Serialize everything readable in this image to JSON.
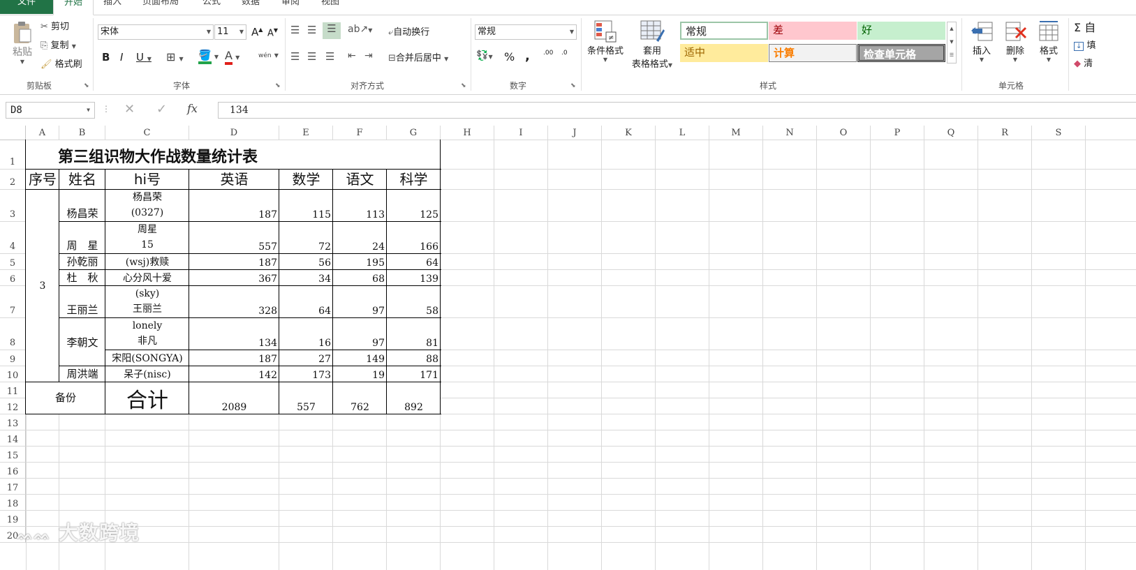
{
  "ribbon_tabs": [
    "文件",
    "开始",
    "插入",
    "页面布局",
    "公式",
    "数据",
    "审阅",
    "视图"
  ],
  "clipboard": {
    "paste": "粘贴",
    "cut": "剪切",
    "copy": "复制",
    "painter": "格式刷",
    "label": "剪贴板"
  },
  "font": {
    "name": "宋体",
    "size": "11",
    "label": "字体",
    "bold": "B",
    "italic": "I",
    "underline": "U",
    "grow": "A",
    "shrink": "A",
    "color_letter": "A",
    "wen": "wén"
  },
  "alignment": {
    "wrap": "自动换行",
    "merge": "合并后居中",
    "label": "对齐方式"
  },
  "number": {
    "format": "常规",
    "percent": "%",
    "comma": ",",
    "inc": ".00",
    "dec": ".0",
    "label": "数字"
  },
  "styles": {
    "conditional": "条件格式",
    "table_fmt_1": "套用",
    "table_fmt_2": "表格格式",
    "cells": [
      "常规",
      "差",
      "好",
      "适中",
      "计算",
      "检查单元格"
    ],
    "label": "样式"
  },
  "cells_group": {
    "insert": "插入",
    "delete": "删除",
    "format": "格式",
    "label": "单元格"
  },
  "editing": {
    "sum": "Σ 自",
    "fill": "填",
    "clear": "清"
  },
  "formula_bar": {
    "name_box": "D8",
    "fx": "fx",
    "value": "134"
  },
  "columns": [
    "A",
    "B",
    "C",
    "D",
    "E",
    "F",
    "G",
    "H",
    "I",
    "J",
    "K",
    "L",
    "M",
    "N",
    "O",
    "P",
    "Q",
    "R",
    "S"
  ],
  "rows": [
    "1",
    "2",
    "3",
    "4",
    "5",
    "6",
    "7",
    "8",
    "9",
    "10",
    "11",
    "12",
    "13",
    "14",
    "15",
    "16",
    "17",
    "18",
    "19",
    "20"
  ],
  "sheet": {
    "title": "第三组识物大作战数量统计表",
    "headers": [
      "序号",
      "姓名",
      "hi号",
      "英语",
      "数学",
      "语文",
      "科学"
    ],
    "group_no": "3",
    "records": [
      {
        "name": "杨昌荣",
        "hi_1": "杨昌荣",
        "hi_2": "(0327)",
        "en": "187",
        "math": "115",
        "cn": "113",
        "sci": "125"
      },
      {
        "name": "周　星",
        "hi_1": "周星",
        "hi_2": "15",
        "en": "557",
        "math": "72",
        "cn": "24",
        "sci": "166"
      },
      {
        "name": "孙乾丽",
        "hi_1": "(wsj)救赎",
        "hi_2": "",
        "en": "187",
        "math": "56",
        "cn": "195",
        "sci": "64"
      },
      {
        "name": "杜　秋",
        "hi_1": "心分风十爱",
        "hi_2": "",
        "en": "367",
        "math": "34",
        "cn": "68",
        "sci": "139"
      },
      {
        "name": "王丽兰",
        "hi_1": "(sky)",
        "hi_2": "王丽兰",
        "en": "328",
        "math": "64",
        "cn": "97",
        "sci": "58"
      },
      {
        "name": "李朝文",
        "hi_1": "lonely",
        "hi_2": "非凡",
        "en": "134",
        "math": "16",
        "cn": "97",
        "sci": "81"
      },
      {
        "name": "",
        "hi_1": "宋阳(SONGYA)",
        "hi_2": "",
        "en": "187",
        "math": "27",
        "cn": "149",
        "sci": "88"
      },
      {
        "name": "周洪端",
        "hi_1": "呆子(nisc)",
        "hi_2": "",
        "en": "142",
        "math": "173",
        "cn": "19",
        "sci": "171"
      }
    ],
    "footer": {
      "backup": "备份",
      "total": "合计",
      "en": "2089",
      "math": "557",
      "cn": "762",
      "sci": "892"
    }
  },
  "watermark": "大数跨境"
}
